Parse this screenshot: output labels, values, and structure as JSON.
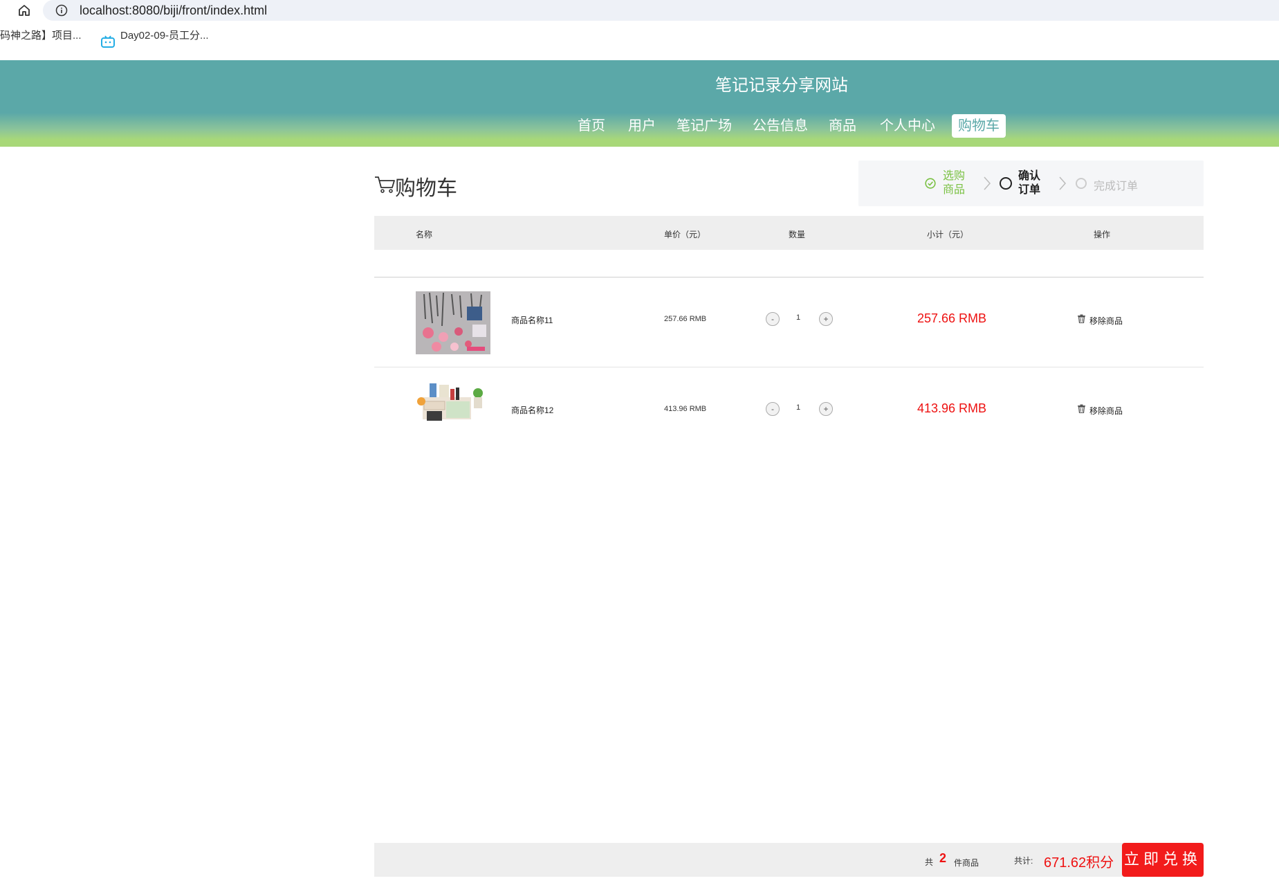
{
  "browser": {
    "url": "localhost:8080/biji/front/index.html",
    "bookmarks": [
      "码神之路】项目...",
      "Day02-09-员工分..."
    ]
  },
  "header": {
    "title": "笔记记录分享网站",
    "nav": [
      "首页",
      "用户",
      "笔记广场",
      "公告信息",
      "商品",
      "个人中心",
      "购物车"
    ],
    "active_nav": "购物车",
    "colors": {
      "top": "#5ba8a8",
      "bottom": "#a8d878"
    }
  },
  "cart": {
    "title": "购物车",
    "steps": [
      {
        "label": "选购商品",
        "state": "done"
      },
      {
        "label": "确认订单",
        "state": "current"
      },
      {
        "label": "完成订单",
        "state": "pending"
      }
    ],
    "columns": [
      "名称",
      "单价（元）",
      "数量",
      "小计（元）",
      "操作"
    ],
    "items": [
      {
        "name": "商品名称11",
        "price": "257.66 RMB",
        "qty": "1",
        "subtotal": "257.66 RMB",
        "action": "移除商品",
        "image": "accessories-photo"
      },
      {
        "name": "商品名称12",
        "price": "413.96 RMB",
        "qty": "1",
        "subtotal": "413.96 RMB",
        "action": "移除商品",
        "image": "desk-organizer-photo"
      }
    ],
    "qty_minus": "-",
    "qty_plus": "+"
  },
  "footer": {
    "count_prefix": "共",
    "count": "2",
    "count_suffix": "件商品",
    "total_label": "共计:",
    "total": "671.62积分",
    "buy_button": "立即兑换"
  },
  "accent": "#ee1111"
}
